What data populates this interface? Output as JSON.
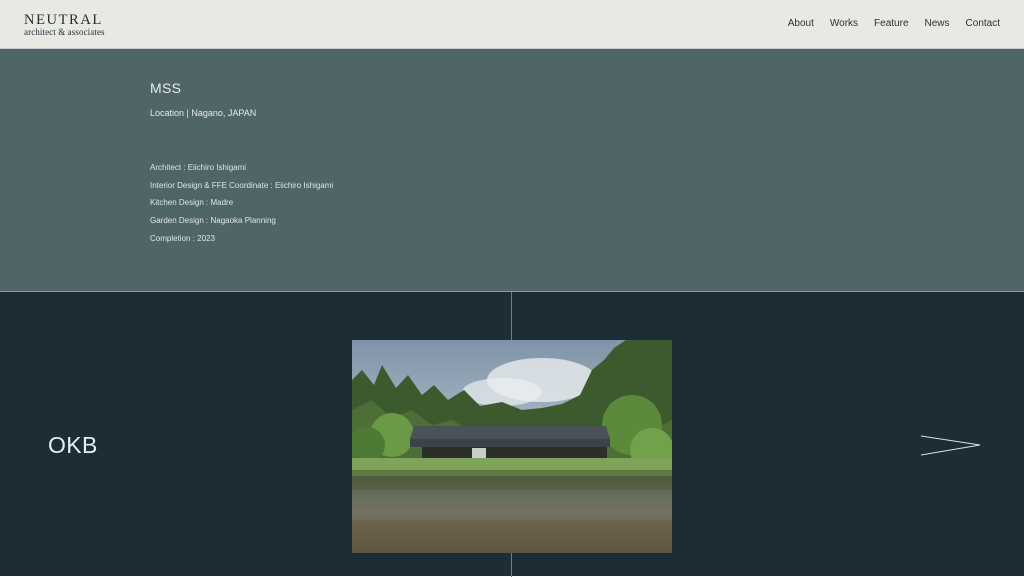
{
  "header": {
    "logo_main": "NEUTRAL",
    "logo_sub": "architect & associates",
    "nav": [
      "About",
      "Works",
      "Feature",
      "News",
      "Contact"
    ]
  },
  "project": {
    "title": "MSS",
    "location": "Location | Nagano, JAPAN",
    "credits": [
      "Architect : Eiichiro Ishigami",
      "Interior Design & FFE Coordinate : Eiichiro Ishigami",
      "Kitchen Design : Madre",
      "Garden Design : Nagaoka Planning",
      "Completion : 2023"
    ]
  },
  "next_project": {
    "title": "OKB",
    "arrow_icon": "arrow-right-icon"
  },
  "colors": {
    "header_bg": "#e9e9e4",
    "info_bg": "#506566",
    "next_bg": "#1c2d36"
  }
}
